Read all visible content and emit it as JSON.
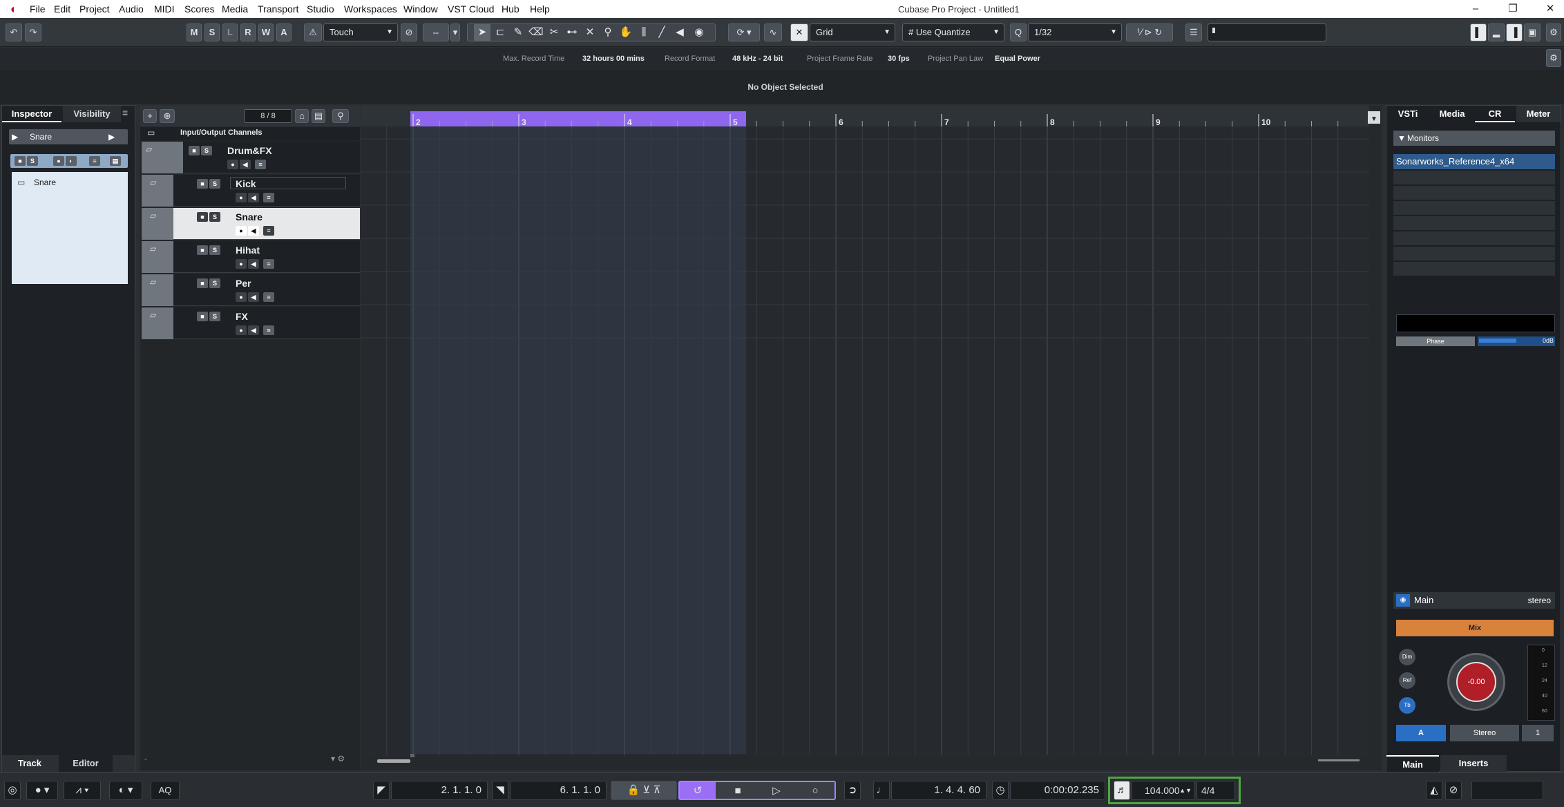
{
  "menubar": {
    "items": [
      "File",
      "Edit",
      "Project",
      "Audio",
      "MIDI",
      "Scores",
      "Media",
      "Transport",
      "Studio",
      "Workspaces",
      "Window",
      "VST Cloud",
      "Hub",
      "Help"
    ],
    "title": "Cubase Pro Project - Untitled1"
  },
  "toolbar": {
    "msl": [
      "M",
      "S",
      "L",
      "R",
      "W",
      "A"
    ],
    "automation_mode": "Touch",
    "snap_type": "Grid",
    "quantize_mode": "Use Quantize",
    "quantize_value": "1/32"
  },
  "info": {
    "max_record_time_label": "Max. Record Time",
    "max_record_time": "32 hours 00 mins",
    "record_format_label": "Record Format",
    "record_format": "48 kHz - 24 bit",
    "frame_rate_label": "Project Frame Rate",
    "frame_rate": "30 fps",
    "pan_law_label": "Project Pan Law",
    "pan_law": "Equal Power"
  },
  "status": "No Object Selected",
  "inspector": {
    "tabs": [
      "Inspector",
      "Visibility"
    ],
    "track_name": "Snare",
    "folder_item": "Snare",
    "bottom_tabs": [
      "Track",
      "Editor"
    ]
  },
  "tracklist": {
    "count": "8 / 8",
    "folder_channels": "Input/Output Channels",
    "tracks": [
      {
        "name": "Drum&FX"
      },
      {
        "name": "Kick"
      },
      {
        "name": "Snare"
      },
      {
        "name": "Hihat"
      },
      {
        "name": "Per"
      },
      {
        "name": "FX"
      }
    ]
  },
  "ruler": {
    "bars": [
      "2",
      "3",
      "4",
      "5",
      "6",
      "7",
      "8",
      "9",
      "10"
    ]
  },
  "right": {
    "tabs": [
      "VSTi",
      "Media",
      "CR",
      "Meter"
    ],
    "monitors_header": "Monitors",
    "monitor_device": "Sonarworks_Reference4_x64",
    "phase_label": "Phase",
    "phase_value": "0dB",
    "main_label": "Main",
    "main_format": "stereo",
    "mix_label": "Mix",
    "knob_value": "-0.00",
    "meter_ticks": [
      "0",
      "12",
      "24",
      "40",
      "60"
    ],
    "btn_a": "A",
    "btn_stereo": "Stereo",
    "btn_1": "1",
    "bottom_tabs": [
      "Main",
      "Inserts"
    ],
    "side_btns": [
      "Dim",
      "Ref",
      "Tb"
    ]
  },
  "transport": {
    "aq": "AQ",
    "left_locator": "2. 1. 1.   0",
    "right_locator": "6. 1. 1.   0",
    "position_bars": "1. 4. 4.  60",
    "position_time": "0:00:02.235",
    "tempo": "104.000",
    "signature": "4/4"
  }
}
